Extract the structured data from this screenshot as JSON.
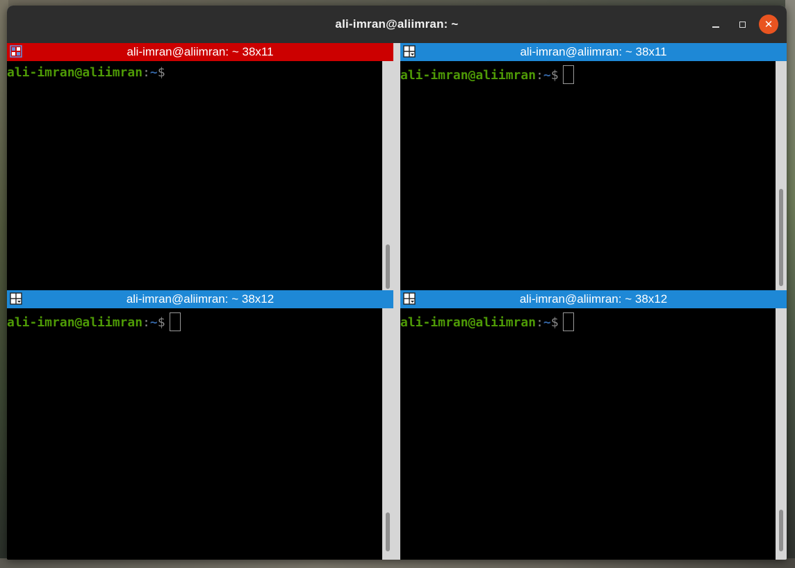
{
  "window": {
    "title": "ali-imran@aliimran: ~",
    "close_symbol": "✕",
    "controls": [
      "minimize-icon",
      "maximize-icon",
      "close-icon"
    ],
    "close_color": "#e95420",
    "titlebar_color": "#2d2d2d"
  },
  "panes": [
    {
      "title": "ali-imran@aliimran: ~ 38x11",
      "header_color": "#cc0000",
      "active": true,
      "prompt": {
        "user_host": "ali-imran@aliimran",
        "colon": ":",
        "path": "~",
        "symbol": "$"
      },
      "has_cursor": false
    },
    {
      "title": "ali-imran@aliimran: ~ 38x11",
      "header_color": "#1e88d6",
      "active": false,
      "prompt": {
        "user_host": "ali-imran@aliimran",
        "colon": ":",
        "path": "~",
        "symbol": "$"
      },
      "has_cursor": true
    },
    {
      "title": "ali-imran@aliimran: ~ 38x12",
      "header_color": "#1e88d6",
      "active": false,
      "prompt": {
        "user_host": "ali-imran@aliimran",
        "colon": ":",
        "path": "~",
        "symbol": "$"
      },
      "has_cursor": true
    },
    {
      "title": "ali-imran@aliimran: ~ 38x12",
      "header_color": "#1e88d6",
      "active": false,
      "prompt": {
        "user_host": "ali-imran@aliimran",
        "colon": ":",
        "path": "~",
        "symbol": "$"
      },
      "has_cursor": true
    }
  ],
  "colors": {
    "prompt_user": "#4e9a06",
    "prompt_path": "#3465a4",
    "terminal_bg": "#000000",
    "active_header": "#cc0000",
    "inactive_header": "#1e88d6"
  }
}
